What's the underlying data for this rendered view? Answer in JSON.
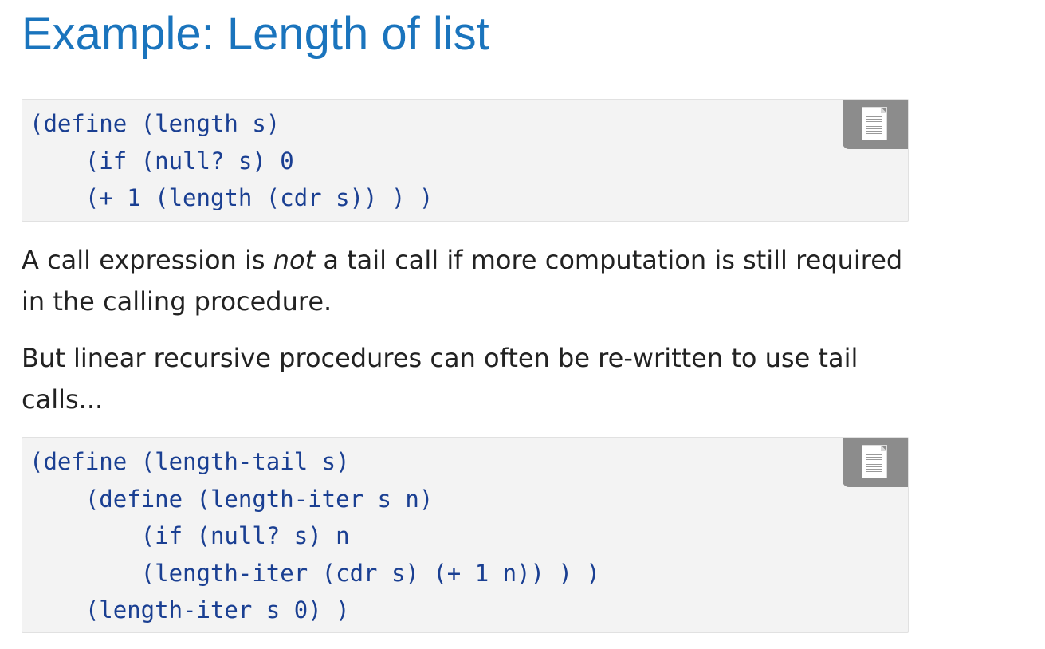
{
  "slide": {
    "title": "Example: Length of list"
  },
  "code_block_1": {
    "lines": [
      "(define (length s)",
      "    (if (null? s) 0",
      "    (+ 1 (length (cdr s)) ) )"
    ],
    "copy_button_icon": "document-copy-icon"
  },
  "paragraph_1": {
    "before": "A call expression is ",
    "emphasis": "not",
    "after": " a tail call if more computation is still required in the calling procedure."
  },
  "paragraph_2": {
    "text": "But linear recursive procedures can often be re-written to use tail calls..."
  },
  "code_block_2": {
    "lines": [
      "(define (length-tail s)",
      "    (define (length-iter s n)",
      "        (if (null? s) n",
      "        (length-iter (cdr s) (+ 1 n)) ) )",
      "    (length-iter s 0) )"
    ],
    "copy_button_icon": "document-copy-icon"
  },
  "colors": {
    "title": "#1a74bd",
    "code_text": "#1a3f92",
    "code_background": "#f3f3f3",
    "copy_button": "#8c8c8c",
    "body_text": "#222222"
  }
}
